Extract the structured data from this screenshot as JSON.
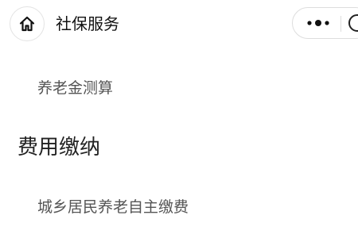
{
  "nav": {
    "title": "社保服务",
    "home_icon": "home-icon",
    "more_icon": "more-dots-icon",
    "close_icon": "close-circle-icon"
  },
  "content": {
    "items_top": [
      {
        "label": "养老金测算"
      }
    ],
    "section": {
      "heading": "费用缴纳",
      "items": [
        {
          "label": "城乡居民养老自主缴费"
        }
      ]
    }
  },
  "colors": {
    "background": "#ffffff",
    "title_text": "#111111",
    "item_text": "#555555",
    "border": "#dddddd"
  }
}
